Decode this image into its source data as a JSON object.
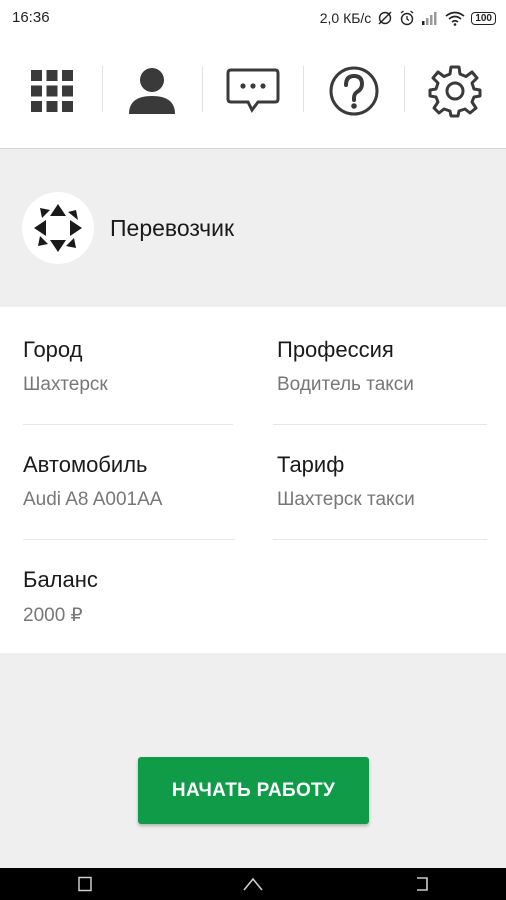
{
  "status_bar": {
    "time": "16:36",
    "net_speed": "2,0 КБ/с",
    "battery": "100"
  },
  "toolbar": {
    "icons": [
      "grid-menu-icon",
      "profile-icon",
      "chat-icon",
      "help-icon",
      "settings-icon"
    ]
  },
  "profile": {
    "company_name": "Перевозчик"
  },
  "info": {
    "city_label": "Город",
    "city_value": "Шахтерск",
    "profession_label": "Профессия",
    "profession_value": "Водитель такси",
    "car_label": "Автомобиль",
    "car_value": "Audi A8 A001AA",
    "tariff_label": "Тариф",
    "tariff_value": "Шахтерск такси",
    "balance_label": "Баланс",
    "balance_value": "2000 ₽"
  },
  "actions": {
    "start_label": "НАЧАТЬ РАБОТУ"
  },
  "colors": {
    "accent": "#0f9b48",
    "icon": "#3a3a3a"
  }
}
